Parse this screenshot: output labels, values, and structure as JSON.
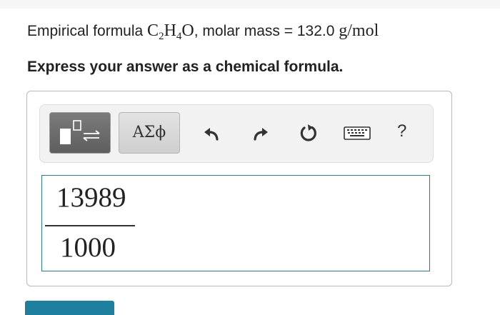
{
  "question": {
    "prefix": "Empirical formula ",
    "formula": {
      "c": "C",
      "c_sub": "2",
      "h": "H",
      "h_sub": "4",
      "o": "O"
    },
    "middle": ", molar mass = 132.0 ",
    "unit": "g/mol"
  },
  "instruction": "Express your answer as a chemical formula.",
  "toolbar": {
    "symbols_label": "ΑΣϕ",
    "help_label": "?",
    "icons": [
      "templates-icon",
      "undo-icon",
      "redo-icon",
      "reset-icon",
      "keyboard-icon",
      "help-icon"
    ]
  },
  "answer": {
    "numerator": "13989",
    "denominator": "1000"
  },
  "colors": {
    "accent": "#1f7f9f",
    "answer_border": "#2e7a8a",
    "templates_button": "#6b6b6b"
  }
}
